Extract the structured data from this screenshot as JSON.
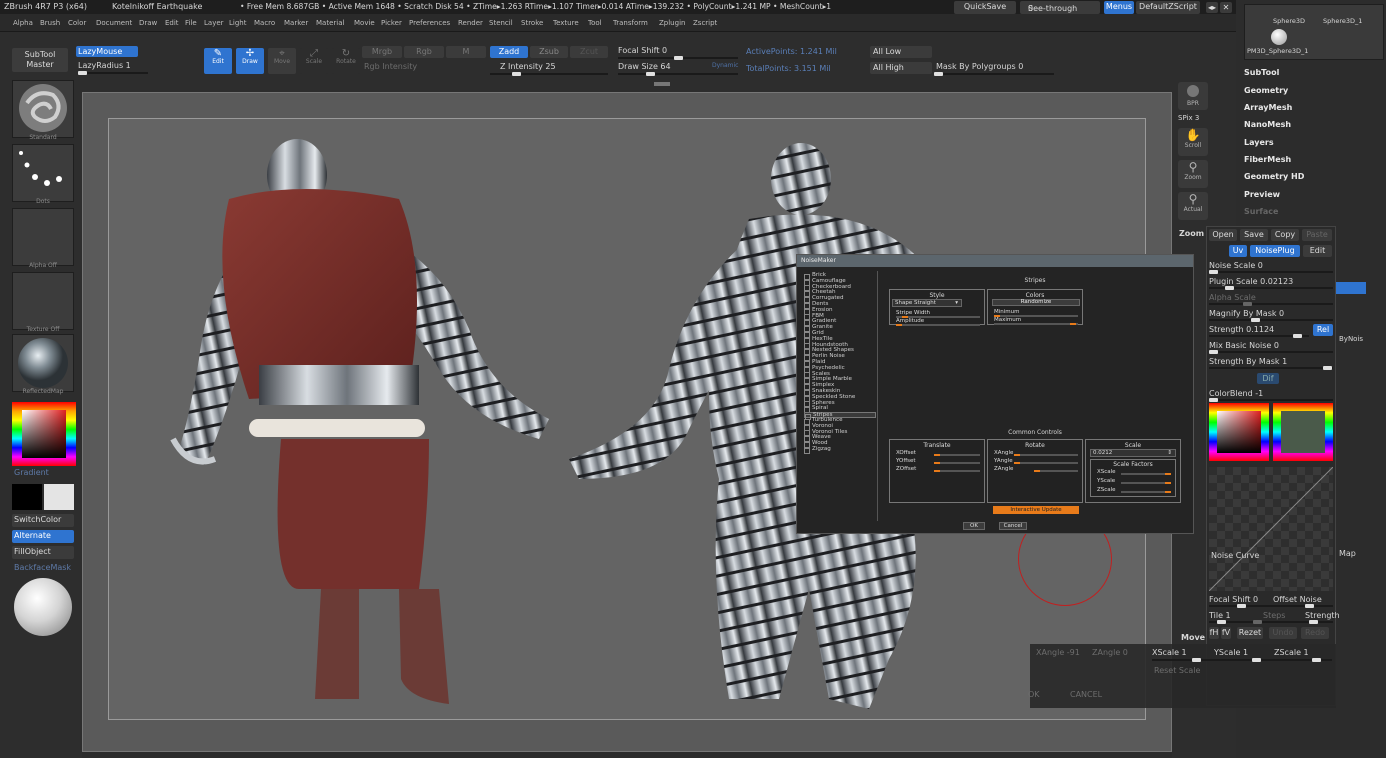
{
  "titlebar": {
    "app": "ZBrush 4R7 P3 (x64)",
    "doc": "Kotelnikoff Earthquake",
    "stats": "• Free Mem 8.687GB • Active Mem 1648 • Scratch Disk 54 • ZTime▸1.263 RTime▸1.107 Timer▸0.014 ATime▸139.232 • PolyCount▸1.241 MP • MeshCount▸1",
    "quicksave": "QuickSave",
    "seethrough": "See-through",
    "seethrough_val": "0",
    "menus": "Menus",
    "defaultzscript": "DefaultZScript"
  },
  "menu": [
    "Alpha",
    "Brush",
    "Color",
    "Document",
    "Draw",
    "Edit",
    "File",
    "Layer",
    "Light",
    "Macro",
    "Marker",
    "Material",
    "Movie",
    "Picker",
    "Preferences",
    "Render",
    "Stencil",
    "Stroke",
    "Texture",
    "Tool",
    "Transform",
    "Zplugin",
    "Zscript"
  ],
  "left": {
    "subtool_master": "SubTool Master",
    "brush_caption": "Standard",
    "stroke_caption": "Dots",
    "alpha_caption": "Alpha Off",
    "texture_caption": "Texture Off",
    "material_caption": "ReflectedMap",
    "gradient": "Gradient",
    "switchcolor": "SwitchColor",
    "alternate": "Alternate",
    "fillobject": "FillObject",
    "backfacemask": "BackfaceMask"
  },
  "top": {
    "lazymouse": "LazyMouse",
    "lazyradius": "LazyRadius 1",
    "edit": "Edit",
    "draw": "Draw",
    "move": "Move",
    "scale": "Scale",
    "rotate": "Rotate",
    "mrgb": "Mrgb",
    "rgb": "Rgb",
    "m": "M",
    "rgb_intensity": "Rgb Intensity",
    "zadd": "Zadd",
    "zsub": "Zsub",
    "zcut": "Zcut",
    "z_intensity": "Z Intensity 25",
    "focal_shift": "Focal Shift 0",
    "draw_size": "Draw Size 64",
    "dynamic": "Dynamic",
    "active_points": "ActivePoints: 1.241 Mil",
    "total_points": "TotalPoints: 3.151 Mil",
    "all_low": "All Low",
    "all_high": "All High",
    "mask_by_polygroups": "Mask By Polygroups 0"
  },
  "shelf": [
    "BPR",
    "SPix 3",
    "Scroll",
    "Zoom",
    "Actual"
  ],
  "tray": {
    "sphere1": "Sphere3D",
    "sphere2": "Sphere3D_1",
    "pm": "PM3D_Sphere3D_1",
    "items": [
      "SubTool",
      "Geometry",
      "ArrayMesh",
      "NanoMesh",
      "Layers",
      "FiberMesh",
      "Geometry HD",
      "Preview",
      "Surface"
    ]
  },
  "noise": {
    "zoom": "Zoom",
    "open": "Open",
    "save": "Save",
    "copy": "Copy",
    "paste": "Paste",
    "uv": "Uv",
    "noiseplug": "NoisePlug",
    "edit": "Edit",
    "noise_scale": "Noise Scale 0",
    "plugin_scale": "Plugin Scale 0.02123",
    "alpha_scale": "Alpha Scale",
    "magnify_by_mask": "Magnify By Mask 0",
    "strength": "Strength 0.1124",
    "rel": "Rel",
    "bynois": "ByNois",
    "mix_basic_noise": "Mix Basic Noise 0",
    "strength_by_mask": "Strength By Mask 1",
    "dif": "Dif",
    "colorblend": "ColorBlend -1",
    "noise_curve": "Noise Curve",
    "map": "Map",
    "focal_shift": "Focal Shift 0",
    "offset_noise": "Offset Noise",
    "tile": "Tile 1",
    "steps": "Steps",
    "strength2": "Strength",
    "fh": "fH",
    "fv": "fV",
    "rezet": "Rezet",
    "undo": "Undo",
    "redo": "Redo",
    "move": "Move"
  },
  "bottom": {
    "xangle": "XAngle -91",
    "zangle": "ZAngle 0",
    "xscale": "XScale 1",
    "yscale": "YScale 1",
    "zscale": "ZScale 1",
    "reset_scale": "Reset Scale",
    "ok": "OK",
    "cancel": "CANCEL"
  },
  "noisemaker": {
    "title": "NoiseMaker",
    "patterns": [
      "Brick",
      "Camouflage",
      "Checkerboard",
      "Cheetah",
      "Corrugated",
      "Dents",
      "Erosion",
      "FBM",
      "Gradient",
      "Granite",
      "Grid",
      "HexTile",
      "Houndstooth",
      "Nested Shapes",
      "Perlin Noise",
      "Plaid",
      "Psychedelic",
      "Scales",
      "Simple Marble",
      "Simplex",
      "Snakeskin",
      "Speckled Stone",
      "Spheres",
      "Spiral",
      "Stripes",
      "Turbulence",
      "Voronoi",
      "Voronoi Tiles",
      "Weave",
      "Wood",
      "Zigzag"
    ],
    "selected": "Stripes",
    "heading": "Stripes",
    "style": "Style",
    "style_value": "Shape Straight",
    "stripe_width": "Stripe Width",
    "amplitude": "Amplitude",
    "colors": "Colors",
    "randomize": "Randomize",
    "minimum": "Minimum",
    "maximum": "Maximum",
    "common_controls": "Common Controls",
    "translate": "Translate",
    "xoffset": "XOffset",
    "yoffset": "YOffset",
    "zoffset": "ZOffset",
    "rotate": "Rotate",
    "xangle": "XAngle",
    "yangle": "YAngle",
    "zangle": "ZAngle",
    "scale": "Scale",
    "scale_value": "0.0212",
    "scale_factors": "Scale Factors",
    "xscale": "XScale",
    "yscale": "YScale",
    "zscale": "ZScale",
    "interactive_update": "Interactive Update",
    "ok": "OK",
    "cancel": "Cancel"
  },
  "colors": {
    "accent": "#2f74d0",
    "orange": "#e87b1a",
    "cloth": "#7a2e2a",
    "metal": "#b8bcc2"
  }
}
